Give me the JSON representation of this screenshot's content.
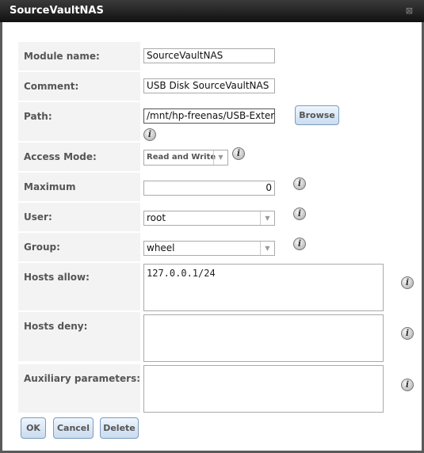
{
  "dialog": {
    "title": "SourceVaultNAS",
    "close_icon": "close-icon"
  },
  "fields": {
    "module_name": {
      "label": "Module name:",
      "value": "SourceVaultNAS"
    },
    "comment": {
      "label": "Comment:",
      "value": "USB Disk SourceVaultNAS"
    },
    "path": {
      "label": "Path:",
      "value": "/mnt/hp-freenas/USB-Extern",
      "browse": "Browse"
    },
    "access_mode": {
      "label": "Access Mode:",
      "value": "Read and Write"
    },
    "max_connections": {
      "label": "Maximum connections:",
      "value": "0"
    },
    "user": {
      "label": "User:",
      "value": "root"
    },
    "group": {
      "label": "Group:",
      "value": "wheel"
    },
    "hosts_allow": {
      "label": "Hosts allow:",
      "value": "127.0.0.1/24"
    },
    "hosts_deny": {
      "label": "Hosts deny:",
      "value": ""
    },
    "aux_params": {
      "label": "Auxiliary parameters:",
      "value": ""
    }
  },
  "buttons": {
    "ok": "OK",
    "cancel": "Cancel",
    "delete": "Delete"
  },
  "info_glyph": "i"
}
